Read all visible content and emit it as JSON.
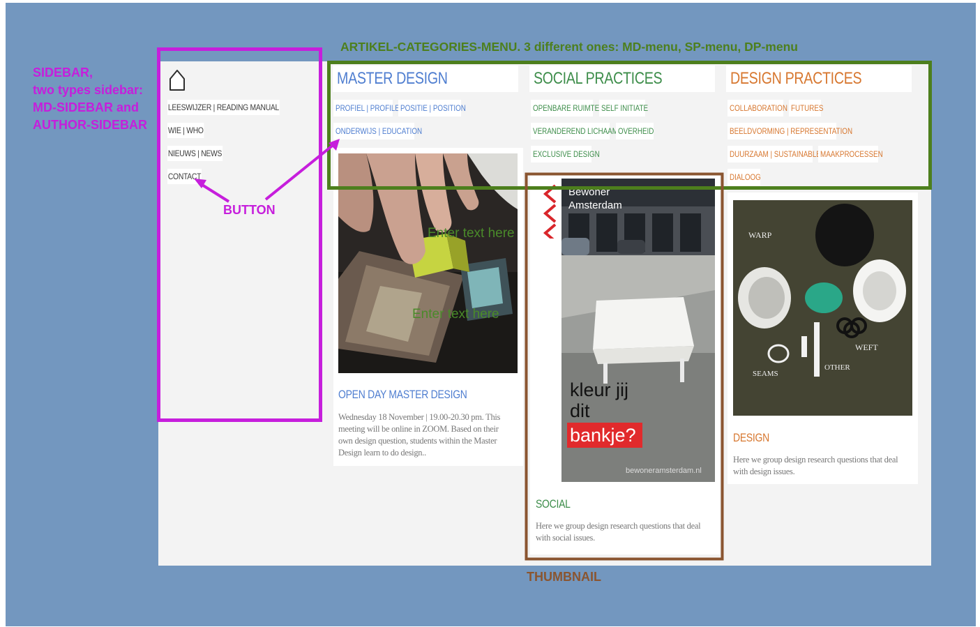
{
  "annotations": {
    "sidebar": [
      "SIDEBAR,",
      "two types sidebar:",
      "MD-SIDEBAR and",
      "AUTHOR-SIDEBAR"
    ],
    "menu": "ARTIKEL-CATEGORIES-MENU. 3 different ones: MD-menu, SP-menu, DP-menu",
    "button": "BUTTON",
    "thumbnail": "THUMBNAIL",
    "colors": {
      "purple": "#c61edc",
      "green": "#4d7f1d",
      "brown": "#8a5530"
    }
  },
  "sidebar": {
    "icon": "home-icon",
    "items": [
      "LEESWIJZER | READING MANUAL",
      "WIE | WHO",
      "NIEUWS | NEWS",
      "CONTACT"
    ]
  },
  "categories": [
    {
      "title": "MASTER DESIGN",
      "color": "#4f7ed0",
      "tags": [
        "PROFIEL | PROFILE",
        "POSITIE | POSITION",
        "ONDERWIJS | EDUCATION"
      ]
    },
    {
      "title": "SOCIAL PRACTICES",
      "color": "#3d8d4a",
      "tags": [
        "OPENBARE RUIMTE",
        "SELF INITIATE",
        "VERANDEREND LICHAAM",
        "OVERHEID",
        "EXCLUSIVE DESIGN"
      ]
    },
    {
      "title": "DESIGN PRACTICES",
      "color": "#d7772f",
      "tags": [
        "COLLABORATION",
        "FUTURES",
        "BEELDVORMING | REPRESENTATION",
        "DUURZAAM | SUSTAINABLE",
        "MAAKPROCESSEN",
        "DIALOOG"
      ]
    }
  ],
  "cards": [
    {
      "title": "OPEN DAY MASTER DESIGN",
      "text": "Wednesday 18 November | 19.00-20.30 pm. This meeting will be online in ZOOM. Based on their own design question, students within the Master Design learn to do design..",
      "overlay": [
        "Enter text here",
        "Enter text here"
      ]
    },
    {
      "title": "SOCIAL",
      "text": "Here we group design research questions that deal with social issues.",
      "poster": {
        "brand": [
          "Bewoner",
          "Amsterdam"
        ],
        "headline": [
          "kleur jij",
          "dit",
          "bankje?"
        ],
        "url": "bewoneramsterdam.nl"
      }
    },
    {
      "title": "DESIGN",
      "text": "Here we group design research questions that deal with design issues.",
      "handwriting": [
        "WARP",
        "WEFT",
        "SEAMS",
        "OTHER"
      ]
    }
  ]
}
